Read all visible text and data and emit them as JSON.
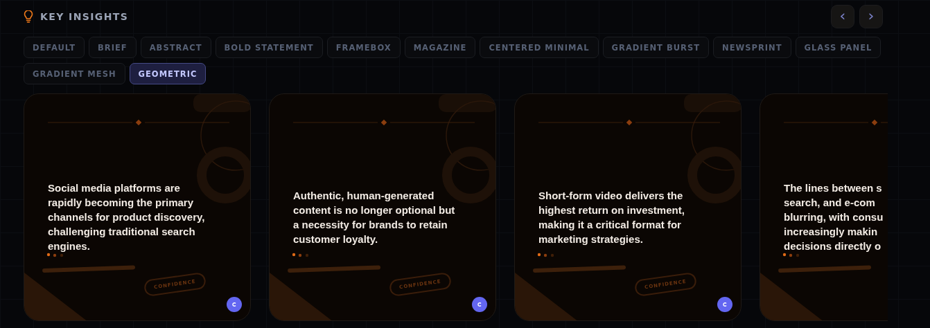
{
  "header": {
    "title": "KEY INSIGHTS"
  },
  "nav": {
    "prev": "‹",
    "next": "›"
  },
  "styles": [
    {
      "label": "DEFAULT",
      "selected": false
    },
    {
      "label": "BRIEF",
      "selected": false
    },
    {
      "label": "ABSTRACT",
      "selected": false
    },
    {
      "label": "BOLD STATEMENT",
      "selected": false
    },
    {
      "label": "FRAMEBOX",
      "selected": false
    },
    {
      "label": "MAGAZINE",
      "selected": false
    },
    {
      "label": "CENTERED MINIMAL",
      "selected": false
    },
    {
      "label": "GRADIENT BURST",
      "selected": false
    },
    {
      "label": "NEWSPRINT",
      "selected": false
    },
    {
      "label": "GLASS PANEL",
      "selected": false
    },
    {
      "label": "GRADIENT MESH",
      "selected": false
    },
    {
      "label": "GEOMETRIC",
      "selected": true
    }
  ],
  "cards": [
    {
      "lines": [
        "Social media platforms are",
        "rapidly becoming the primary",
        "channels for product discovery,",
        "challenging traditional search",
        "engines."
      ],
      "stamp": "CONFIDENCE"
    },
    {
      "lines": [
        "Authentic, human-generated",
        "content is no longer optional but",
        "a necessity for brands to retain",
        "customer loyalty."
      ],
      "stamp": "CONFIDENCE"
    },
    {
      "lines": [
        "Short-form video delivers the",
        "highest return on investment,",
        "making it a critical format for",
        "marketing strategies."
      ],
      "stamp": "CONFIDENCE"
    },
    {
      "lines": [
        "The lines between s",
        "search, and e-com",
        "blurring, with consu",
        "increasingly makin",
        "decisions directly o"
      ]
    }
  ]
}
